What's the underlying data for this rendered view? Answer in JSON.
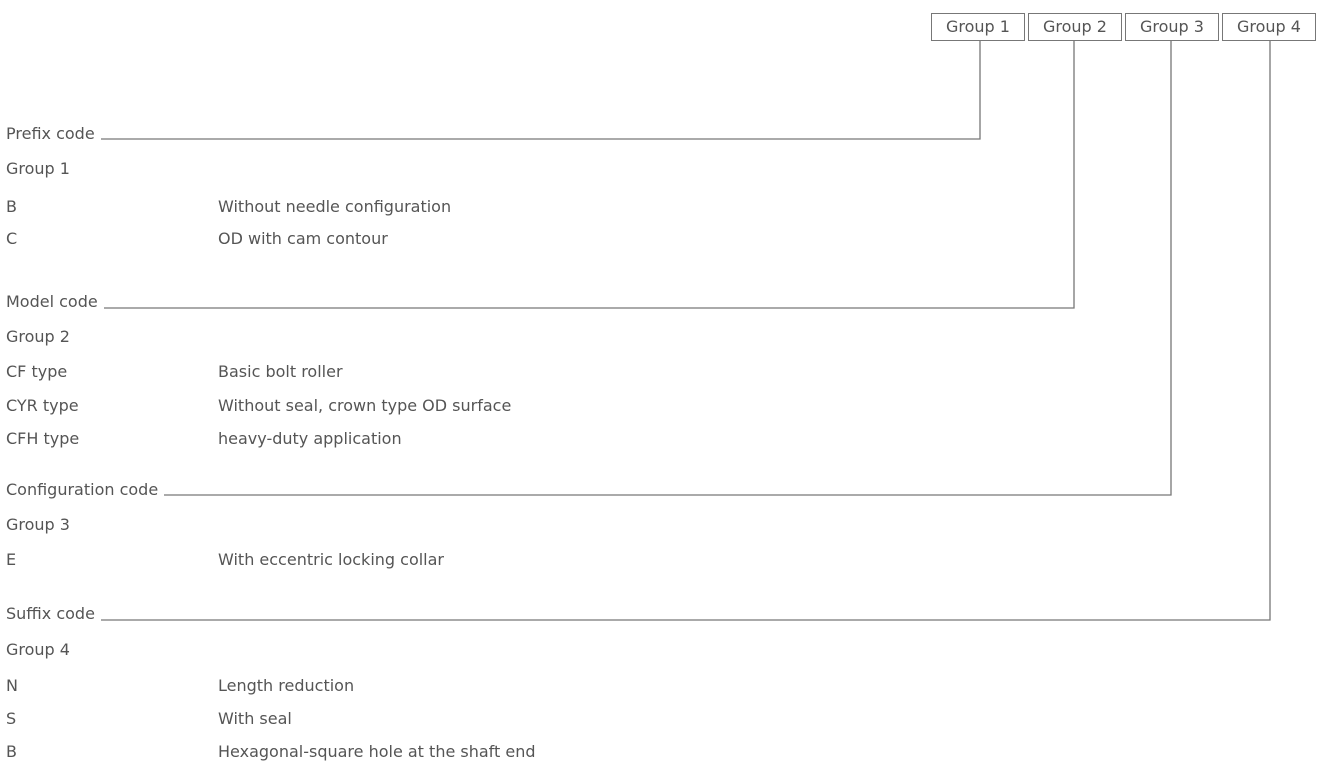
{
  "header_groups": [
    "Group 1",
    "Group 2",
    "Group 3",
    "Group 4"
  ],
  "sections": [
    {
      "title": "Prefix code",
      "group": "Group 1",
      "items": [
        {
          "code": "B",
          "desc": "Without needle configuration"
        },
        {
          "code": "C",
          "desc": "OD with cam contour"
        }
      ]
    },
    {
      "title": "Model code",
      "group": "Group 2",
      "items": [
        {
          "code": "CF type",
          "desc": "Basic bolt roller"
        },
        {
          "code": "CYR type",
          "desc": "Without seal, crown type OD surface"
        },
        {
          "code": "CFH type",
          "desc": "heavy-duty application"
        }
      ]
    },
    {
      "title": "Configuration code",
      "group": "Group 3",
      "items": [
        {
          "code": "E",
          "desc": "With eccentric locking collar"
        }
      ]
    },
    {
      "title": "Suffix code",
      "group": "Group 4",
      "items": [
        {
          "code": "N",
          "desc": "Length reduction"
        },
        {
          "code": "S",
          "desc": "With seal"
        },
        {
          "code": "B",
          "desc": "Hexagonal-square hole at the shaft end"
        }
      ]
    }
  ]
}
